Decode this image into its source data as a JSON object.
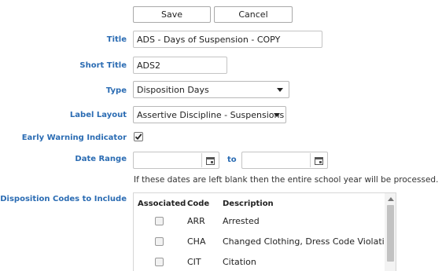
{
  "toolbar": {
    "save_label": "Save",
    "cancel_label": "Cancel"
  },
  "form": {
    "title_label": "Title",
    "title_value": "ADS - Days of Suspension -  COPY",
    "short_title_label": "Short Title",
    "short_title_value": "ADS2",
    "type_label": "Type",
    "type_value": "Disposition Days",
    "label_layout_label": "Label Layout",
    "label_layout_value": "Assertive Discipline - Suspensions",
    "early_warning_label": "Early Warning Indicator",
    "early_warning_checked": true,
    "date_range_label": "Date Range",
    "date_from_value": "",
    "date_to_label": "to",
    "date_to_value": "",
    "date_hint": "If these dates are left blank then the entire school year will be processed.",
    "codes_label": "Disposition Codes to Include"
  },
  "codes_table": {
    "headers": {
      "associated": "Associated",
      "code": "Code",
      "description": "Description"
    },
    "rows": [
      {
        "code": "ARR",
        "description": "Arrested",
        "checked": false
      },
      {
        "code": "CHA",
        "description": "Changed Clothing, Dress Code Violation",
        "checked": false
      },
      {
        "code": "CIT",
        "description": "Citation",
        "checked": false
      }
    ]
  },
  "icons": {
    "calendar": "calendar-icon",
    "checkmark": "checkmark-icon",
    "dropdown": "chevron-down-icon"
  }
}
